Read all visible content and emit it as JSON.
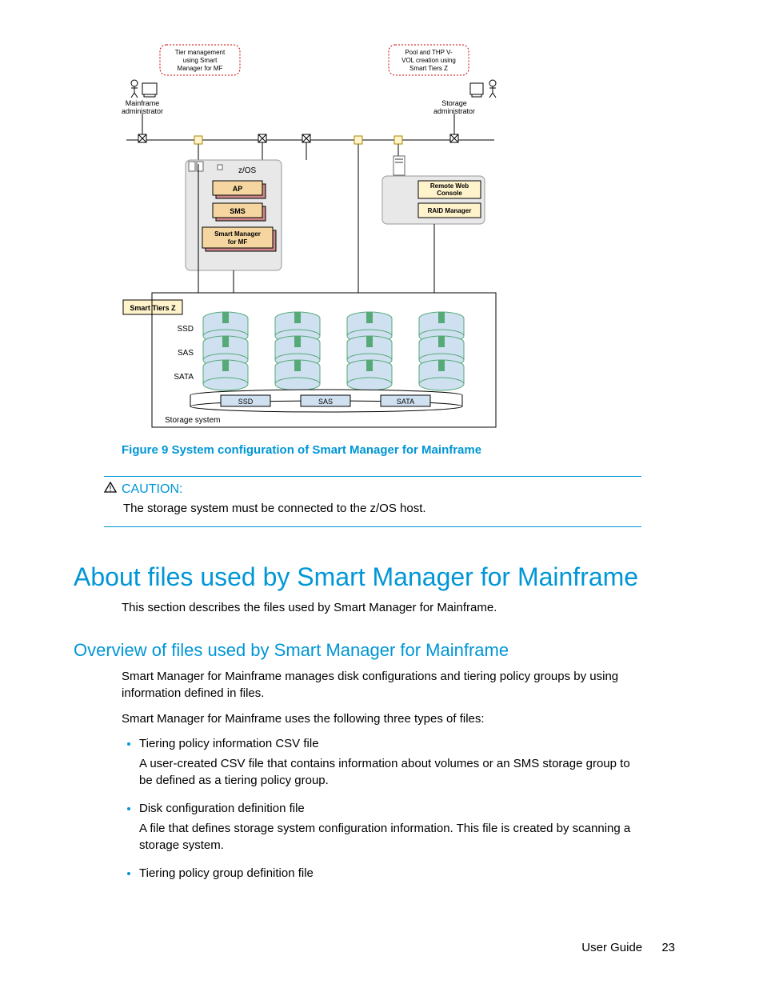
{
  "diagram": {
    "callout_left": "Tier management using Smart Manager for MF",
    "callout_right": "Pool and THP V-VOL creation using Smart Tiers Z",
    "admin_left": "Mainframe administrator",
    "admin_right": "Storage administrator",
    "zos": "z/OS",
    "box_ap": "AP",
    "box_sms": "SMS",
    "box_smm": "Smart Manager for MF",
    "box_rwc": "Remote Web Console",
    "box_raid": "RAID Manager",
    "box_stz": "Smart Tiers Z",
    "tier_ssd": "SSD",
    "tier_sas": "SAS",
    "tier_sata": "SATA",
    "lbl_ssd": "SSD",
    "lbl_sas": "SAS",
    "lbl_sata": "SATA",
    "storage_system": "Storage system"
  },
  "figure_caption": "Figure 9 System configuration of Smart Manager for Mainframe",
  "caution": {
    "label": "CAUTION:",
    "text": "The storage system must be connected to the z/OS host."
  },
  "h1": "About files used by Smart Manager for Mainframe",
  "intro": "This section describes the files used by Smart Manager for Mainframe.",
  "h2": "Overview of files used by Smart Manager for Mainframe",
  "p1": "Smart Manager for Mainframe manages disk configurations and tiering policy groups by using information defined in files.",
  "p2": "Smart Manager for Mainframe uses the following three types of files:",
  "list": {
    "item1_title": "Tiering policy information CSV file",
    "item1_body": "A user-created CSV file that contains information about volumes or an SMS storage group to be defined as a tiering policy group.",
    "item2_title": "Disk configuration definition file",
    "item2_body": "A file that defines storage system configuration information. This file is created by scanning a storage system.",
    "item3_title": "Tiering policy group definition file"
  },
  "footer": {
    "label": "User Guide",
    "page": "23"
  }
}
